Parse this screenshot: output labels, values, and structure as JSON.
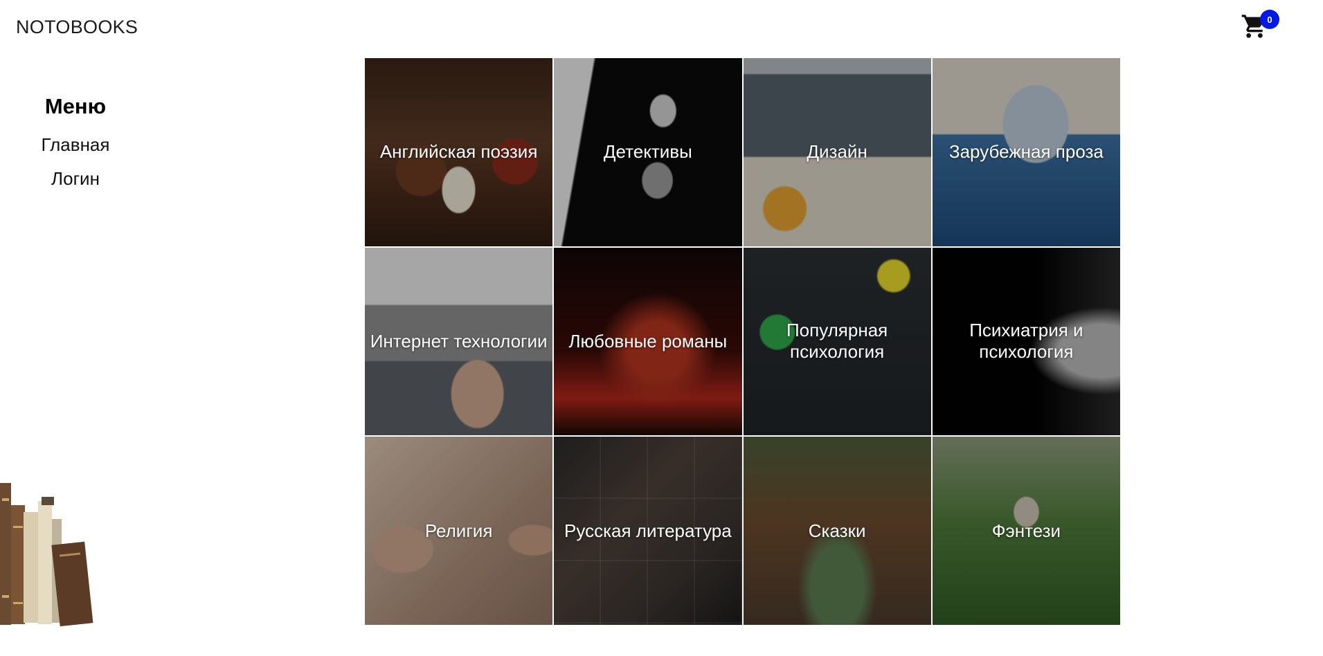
{
  "header": {
    "brand": "NOTOBOOKS",
    "cart": {
      "icon": "cart-icon",
      "count": "0",
      "badge_color": "#0019e6"
    }
  },
  "sidebar": {
    "title": "Меню",
    "items": [
      {
        "label": "Главная"
      },
      {
        "label": "Логин"
      }
    ],
    "decoration": "books-illustration"
  },
  "categories": [
    {
      "label": "Английская поэзия"
    },
    {
      "label": "Детективы"
    },
    {
      "label": "Дизайн"
    },
    {
      "label": "Зарубежная проза"
    },
    {
      "label": "Интернет технологии"
    },
    {
      "label": "Любовные романы"
    },
    {
      "label": "Популярная психология"
    },
    {
      "label": "Психиатрия и психология"
    },
    {
      "label": "Религия"
    },
    {
      "label": "Русская литература"
    },
    {
      "label": "Сказки"
    },
    {
      "label": "Фэнтези"
    }
  ]
}
